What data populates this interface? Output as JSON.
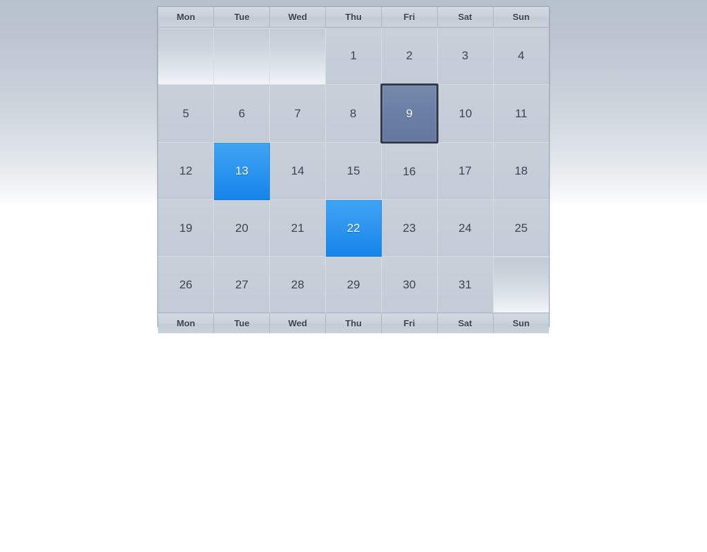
{
  "calendar": {
    "weekday_headers": [
      "Mon",
      "Tue",
      "Wed",
      "Thu",
      "Fri",
      "Sat",
      "Sun"
    ],
    "weekday_footers": [
      "Mon",
      "Tue",
      "Wed",
      "Thu",
      "Fri",
      "Sat",
      "Sun"
    ],
    "colors": {
      "page_background_top": "#b7c1cd",
      "page_background_bottom": "#ffffff",
      "cell_background": "#c5cdd8",
      "cell_text": "#3d4450",
      "header_text": "#3b424d",
      "highlight_blue": "#1e8ded",
      "highlight_text": "#ffffff",
      "selected_fill": "#6a7ea4",
      "selected_border": "#333c4d",
      "grid_line": "#d7dde4",
      "frame_border": "#9aa5b2"
    },
    "weeks": [
      [
        {
          "label": "",
          "state": "empty"
        },
        {
          "label": "",
          "state": "empty"
        },
        {
          "label": "",
          "state": "empty"
        },
        {
          "label": "1",
          "state": "normal"
        },
        {
          "label": "2",
          "state": "normal"
        },
        {
          "label": "3",
          "state": "normal"
        },
        {
          "label": "4",
          "state": "normal"
        }
      ],
      [
        {
          "label": "5",
          "state": "normal"
        },
        {
          "label": "6",
          "state": "normal"
        },
        {
          "label": "7",
          "state": "normal"
        },
        {
          "label": "8",
          "state": "normal"
        },
        {
          "label": "9",
          "state": "selected"
        },
        {
          "label": "10",
          "state": "normal"
        },
        {
          "label": "11",
          "state": "normal"
        }
      ],
      [
        {
          "label": "12",
          "state": "normal"
        },
        {
          "label": "13",
          "state": "highlight"
        },
        {
          "label": "14",
          "state": "normal"
        },
        {
          "label": "15",
          "state": "normal"
        },
        {
          "label": "16",
          "state": "normal"
        },
        {
          "label": "17",
          "state": "normal"
        },
        {
          "label": "18",
          "state": "normal"
        }
      ],
      [
        {
          "label": "19",
          "state": "normal"
        },
        {
          "label": "20",
          "state": "normal"
        },
        {
          "label": "21",
          "state": "normal"
        },
        {
          "label": "22",
          "state": "highlight"
        },
        {
          "label": "23",
          "state": "normal"
        },
        {
          "label": "24",
          "state": "normal"
        },
        {
          "label": "25",
          "state": "normal"
        }
      ],
      [
        {
          "label": "26",
          "state": "normal"
        },
        {
          "label": "27",
          "state": "normal"
        },
        {
          "label": "28",
          "state": "normal"
        },
        {
          "label": "29",
          "state": "normal"
        },
        {
          "label": "30",
          "state": "normal"
        },
        {
          "label": "31",
          "state": "normal"
        },
        {
          "label": "",
          "state": "empty"
        }
      ]
    ]
  }
}
